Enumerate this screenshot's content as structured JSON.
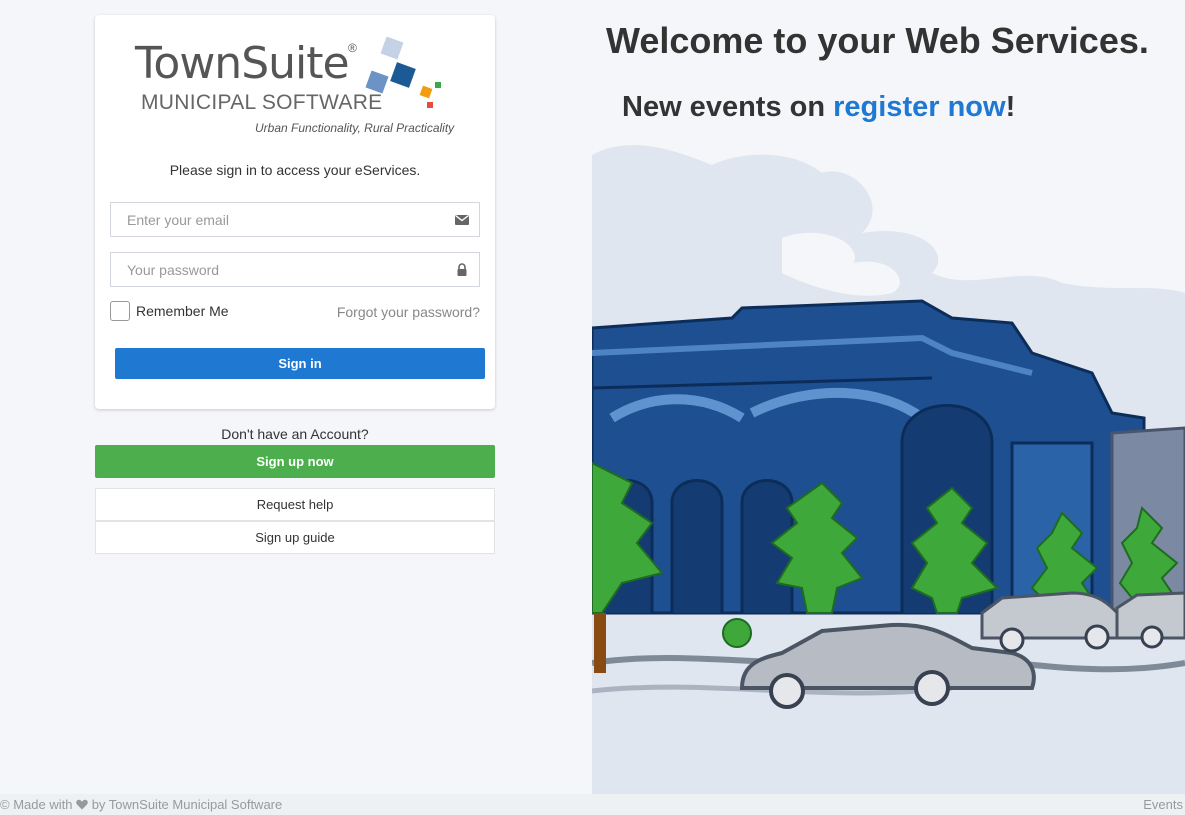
{
  "brand": {
    "name": "TownSuite",
    "registered": "®",
    "subtitle": "MUNICIPAL SOFTWARE",
    "tagline": "Urban Functionality, Rural Practicality"
  },
  "login": {
    "intro": "Please sign in to access your eServices.",
    "email_placeholder": "Enter your email",
    "password_placeholder": "Your password",
    "remember_label": "Remember Me",
    "forgot_label": "Forgot your password?",
    "signin_label": "Sign in"
  },
  "signup": {
    "prompt": "Don't have an Account?",
    "signup_label": "Sign up now",
    "help_label": "Request help",
    "guide_label": "Sign up guide"
  },
  "hero": {
    "welcome": "Welcome to your Web Services.",
    "news_prefix": "New events on ",
    "news_link": "register now",
    "news_suffix": "!"
  },
  "footer": {
    "made_prefix": "© Made with",
    "made_suffix": "by TownSuite Municipal Software",
    "right_link": "Events"
  },
  "colors": {
    "primary": "#1f78d1",
    "success": "#4cae4c",
    "building": "#1d4f91",
    "tree": "#3ea83a"
  },
  "icons": [
    "envelope-icon",
    "lock-icon",
    "heart-icon"
  ]
}
